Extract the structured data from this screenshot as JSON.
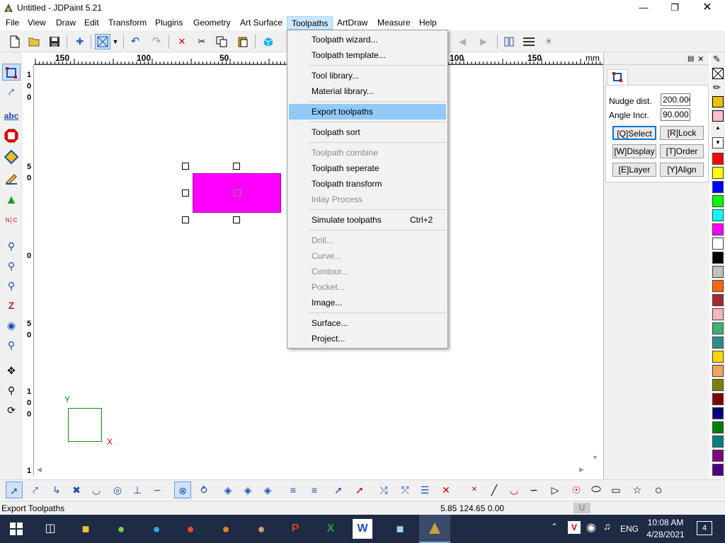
{
  "window": {
    "title": "Untitled - JDPaint 5.21"
  },
  "menu": [
    "File",
    "View",
    "Draw",
    "Edit",
    "Transform",
    "Plugins",
    "Geometry",
    "Art Surface",
    "Toolpaths",
    "ArtDraw",
    "Measure",
    "Help"
  ],
  "dropdown": {
    "items": [
      {
        "label": "Toolpath wizard...",
        "enabled": true
      },
      {
        "label": "Toolpath template...",
        "enabled": true
      },
      {
        "label": "Tool library...",
        "enabled": true
      },
      {
        "label": "Material library...",
        "enabled": true
      },
      {
        "label": "Export toolpaths",
        "enabled": true,
        "highlighted": true
      },
      {
        "label": "Toolpath sort",
        "enabled": true
      },
      {
        "label": "Toolpath combine",
        "enabled": false
      },
      {
        "label": "Toolpath seperate",
        "enabled": true
      },
      {
        "label": "Toolpath transform",
        "enabled": true
      },
      {
        "label": "Inlay Process",
        "enabled": false
      },
      {
        "label": "Simulate toolpaths",
        "enabled": true,
        "shortcut": "Ctrl+2"
      },
      {
        "label": "Drill...",
        "enabled": false
      },
      {
        "label": "Curve...",
        "enabled": false
      },
      {
        "label": "Contour...",
        "enabled": false
      },
      {
        "label": "Pocket...",
        "enabled": false
      },
      {
        "label": "Image...",
        "enabled": true
      },
      {
        "label": "Surface...",
        "enabled": true
      },
      {
        "label": "Project...",
        "enabled": true
      }
    ]
  },
  "ruler": {
    "h_labels": [
      "150",
      "100",
      "50",
      "100",
      "150",
      "mm"
    ],
    "v_labels": [
      "1",
      "0",
      "0",
      "5",
      "0",
      "0",
      "5",
      "0",
      "1",
      "0",
      "0",
      "1"
    ]
  },
  "canvas": {
    "axis_y": "Y",
    "axis_x": "X",
    "rect_color": "#ff00ff"
  },
  "panel": {
    "nudge_label": "Nudge dist.",
    "nudge_value": "200.000",
    "angle_label": "Angle Incr.",
    "angle_value": "90.000",
    "buttons": [
      "[Q]Select",
      "[R]Lock",
      "[W]Display",
      "[T]Order",
      "[E]Layer",
      "[Y]Align"
    ]
  },
  "palette": [
    "#ff0000",
    "#ffff00",
    "#0000ff",
    "#00ff00",
    "#00ffff",
    "#ff00ff",
    "#ffffff",
    "#000000",
    "#c0c0c0",
    "#ff6600",
    "#a52a2a",
    "#ffb6c1",
    "#3cb371",
    "#2e8b8b",
    "#ffd700",
    "#f4a460",
    "#808000",
    "#800000",
    "#000080",
    "#008000",
    "#008080",
    "#800080",
    "#4b0082"
  ],
  "status": {
    "message": "Export Toolpaths",
    "coords": "5.85 124.65 0.00",
    "mode": "U"
  },
  "taskbar": {
    "time": "10:08 AM",
    "date": "4/28/2021",
    "lang": "ENG",
    "notifications": "4"
  }
}
